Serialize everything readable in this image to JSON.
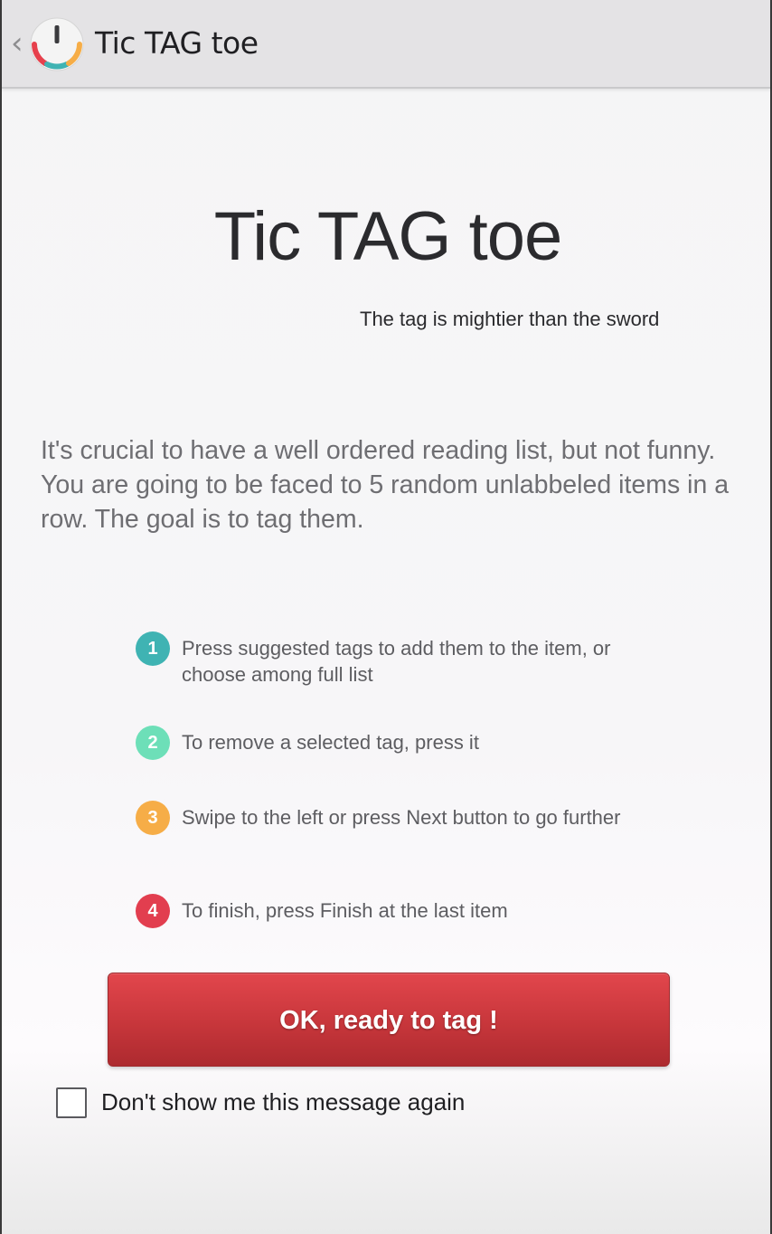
{
  "actionbar": {
    "back_glyph": "‹",
    "logo_icon": "tictagtoe-logo-icon",
    "title": "Tic TAG toe"
  },
  "main": {
    "title": "Tic TAG toe",
    "subtitle": "The tag is mightier than the sword",
    "intro": "It's crucial to have a well ordered reading list, but not funny. You are going to be faced to 5 random unlabbeled items in a row. The goal is to tag them."
  },
  "steps": [
    {
      "number": "1",
      "text": "Press suggested tags to add them to the item, or choose among full list",
      "color": "#3fb3b3"
    },
    {
      "number": "2",
      "text": "To remove a selected tag, press it",
      "color": "#6ddfb8"
    },
    {
      "number": "3",
      "text": "Swipe to the left or press Next button to go further",
      "color": "#f6ad47"
    },
    {
      "number": "4",
      "text": "To finish, press Finish at the last item",
      "color": "#e23e4f"
    }
  ],
  "ok_button": {
    "label": "OK, ready to tag !",
    "color": "#d13c42"
  },
  "dont_show": {
    "label": "Don't show me this message again",
    "checked": false
  }
}
